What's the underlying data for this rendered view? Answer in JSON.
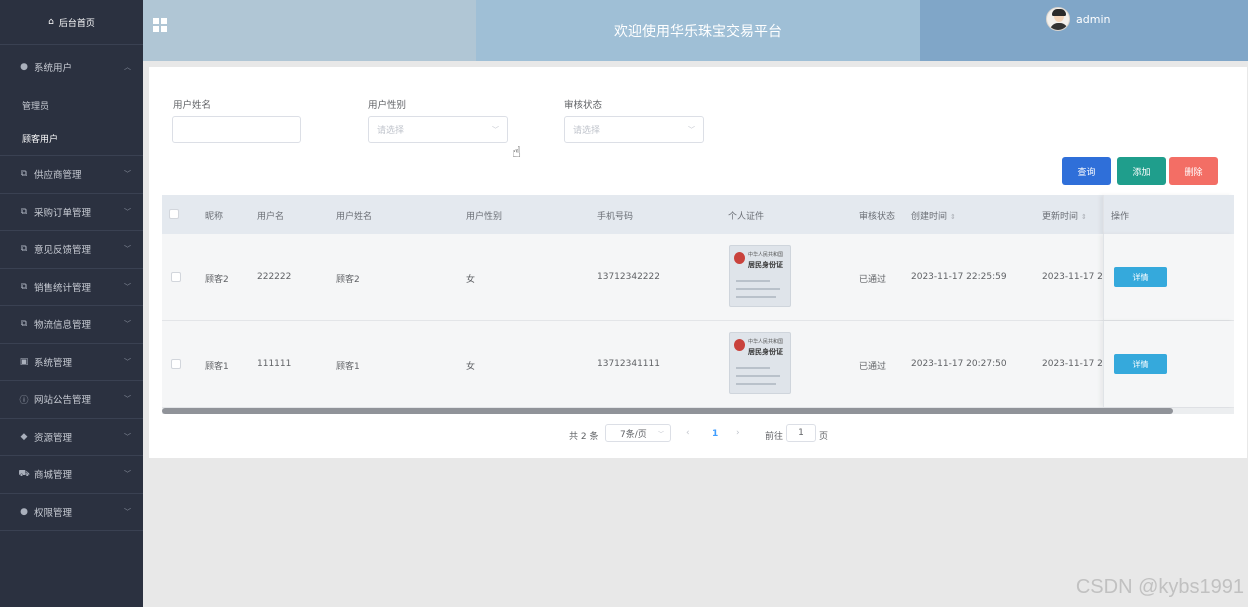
{
  "sidebar": {
    "home_label": "后台首页",
    "items": [
      {
        "label": "系统用户",
        "icon": "user-icon",
        "open": true,
        "children": [
          {
            "label": "管理员"
          },
          {
            "label": "顾客用户",
            "active": true
          }
        ]
      },
      {
        "label": "供应商管理",
        "icon": "share-icon"
      },
      {
        "label": "采购订单管理",
        "icon": "share-icon"
      },
      {
        "label": "意见反馈管理",
        "icon": "share-icon"
      },
      {
        "label": "销售统计管理",
        "icon": "share-icon"
      },
      {
        "label": "物流信息管理",
        "icon": "share-icon"
      },
      {
        "label": "系统管理",
        "icon": "picture-icon"
      },
      {
        "label": "网站公告管理",
        "icon": "info-icon"
      },
      {
        "label": "资源管理",
        "icon": "location-icon"
      },
      {
        "label": "商城管理",
        "icon": "cart-icon"
      },
      {
        "label": "权限管理",
        "icon": "user-icon"
      }
    ]
  },
  "header": {
    "title": "欢迎使用华乐珠宝交易平台",
    "username": "admin"
  },
  "filters": {
    "name_label": "用户姓名",
    "name_value": "",
    "gender_label": "用户性别",
    "gender_placeholder": "请选择",
    "status_label": "审核状态",
    "status_placeholder": "请选择"
  },
  "buttons": {
    "search": "查询",
    "add": "添加",
    "delete": "删除",
    "detail": "详情"
  },
  "table": {
    "columns": [
      "昵称",
      "用户名",
      "用户姓名",
      "用户性别",
      "手机号码",
      "个人证件",
      "审核状态",
      "创建时间",
      "更新时间",
      "操作"
    ],
    "rows": [
      {
        "nickname": "顾客2",
        "username": "222222",
        "realname": "顾客2",
        "gender": "女",
        "phone": "13712342222",
        "status": "已通过",
        "created": "2023-11-17 22:25:59",
        "updated": "2023-11-17 22:"
      },
      {
        "nickname": "顾客1",
        "username": "111111",
        "realname": "顾客1",
        "gender": "女",
        "phone": "13712341111",
        "status": "已通过",
        "created": "2023-11-17 20:27:50",
        "updated": "2023-11-17 20:"
      }
    ],
    "idcard_line1": "中华人民共和国",
    "idcard_line2": "居民身份证"
  },
  "pagination": {
    "total_text": "共 2 条",
    "page_size": "7条/页",
    "current_page": "1",
    "goto_label": "前往",
    "goto_value": "1",
    "page_suffix": "页"
  },
  "watermark": "CSDN @kybs1991",
  "colors": {
    "sidebar_bg": "#2b3140",
    "search_btn": "#2f6fd9",
    "add_btn": "#1f9e8c",
    "delete_btn": "#f36e65",
    "detail_btn": "#35a9dc"
  }
}
